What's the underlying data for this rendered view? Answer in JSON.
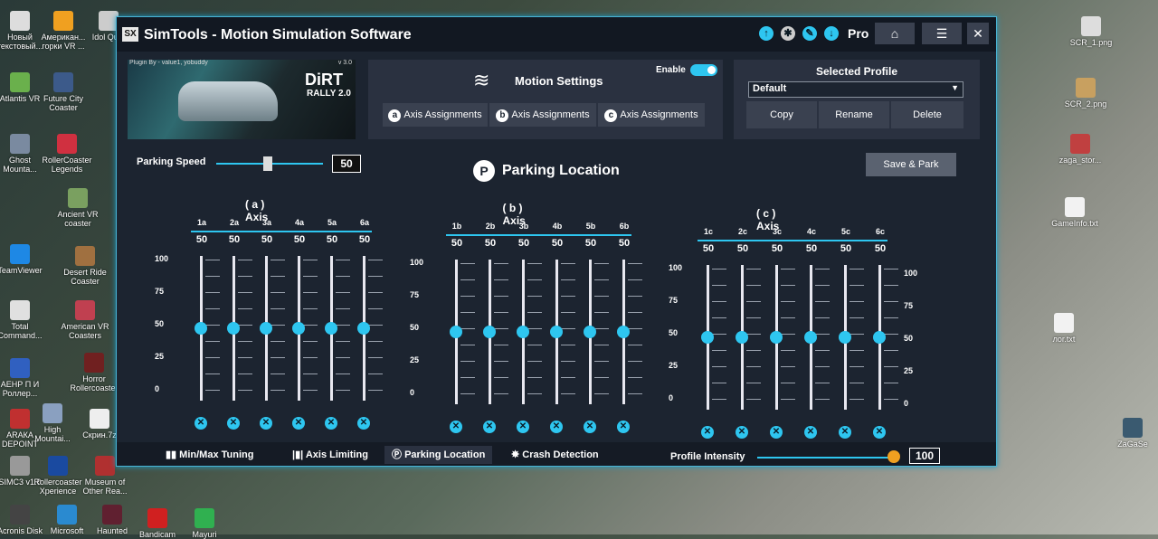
{
  "desktop": {
    "icons_left_col1": [
      "Новый\nтекстовый...",
      "Atlantis VR",
      "Ghost\nMounta...",
      "TeamViewer",
      "Total\nCommand...",
      "АЕНР П И\nРоллер...",
      "АRАКА\nDEPOINT",
      "SIMC3 v1.0",
      "Acronis Disk"
    ],
    "icons_left_col2": [
      "Американ...\nгорки VR ...",
      "Future City\nCoaster",
      "RollerCoaster\nLegends",
      "Ancient VR\ncoaster",
      "Desert Ride\nCoaster",
      "American VR\nCoasters",
      "Horror\nRollercoaster",
      "High\nMountai...",
      "Rollercoaster\nXperience",
      "Microsoft"
    ],
    "icons_left_col3": [
      "Idol Qu...",
      "Скрин.7z",
      "Museum of\nOther Rea...",
      "Haunted"
    ],
    "icons_bottom": [
      "Bandicam",
      "Mayuri"
    ],
    "icons_right": [
      "SCR_1.png",
      "SCR_2.png",
      "zaga_stor...",
      "GameInfo.txt",
      "лor.txt",
      "ZaGaSe"
    ]
  },
  "window": {
    "title": "SimTools - Motion Simulation Software",
    "logo_text": "SX",
    "edition": "Pro",
    "top_icons": [
      "arrow-up-icon",
      "gear-icon",
      "pencil-icon",
      "arrow-down-icon"
    ],
    "buttons": {
      "home": "⌂",
      "menu": "☰",
      "close": "✕"
    }
  },
  "plugin": {
    "by": "Plugin By - value1, yobuddy",
    "version": "v 3.0",
    "game_logo_1": "DiRT",
    "game_logo_2": "RALLY 2.0"
  },
  "motion": {
    "title": "Motion Settings",
    "enable_label": "Enable",
    "enabled": true,
    "axis_buttons": [
      {
        "letter": "a",
        "label": "Axis Assignments"
      },
      {
        "letter": "b",
        "label": "Axis Assignments"
      },
      {
        "letter": "c",
        "label": "Axis Assignments"
      }
    ]
  },
  "profile": {
    "title": "Selected Profile",
    "selected": "Default",
    "buttons": [
      "Copy",
      "Rename",
      "Delete"
    ]
  },
  "parking": {
    "speed_label": "Parking Speed",
    "speed_value": "50",
    "title": "Parking Location",
    "save_label": "Save & Park"
  },
  "axes": [
    {
      "title": "( a ) Axis",
      "channels": [
        "1a",
        "2a",
        "3a",
        "4a",
        "5a",
        "6a"
      ],
      "values": [
        "50",
        "50",
        "50",
        "50",
        "50",
        "50"
      ]
    },
    {
      "title": "( b ) Axis",
      "channels": [
        "1b",
        "2b",
        "3b",
        "4b",
        "5b",
        "6b"
      ],
      "values": [
        "50",
        "50",
        "50",
        "50",
        "50",
        "50"
      ]
    },
    {
      "title": "( c ) Axis",
      "channels": [
        "1c",
        "2c",
        "3c",
        "4c",
        "5c",
        "6c"
      ],
      "values": [
        "50",
        "50",
        "50",
        "50",
        "50",
        "50"
      ]
    }
  ],
  "scale_labels": [
    "100",
    "75",
    "50",
    "25",
    "0"
  ],
  "bottom_tabs": [
    {
      "label": "Min/Max Tuning",
      "active": false
    },
    {
      "label": "Axis Limiting",
      "active": false
    },
    {
      "label": "Parking Location",
      "active": true
    },
    {
      "label": "Crash Detection",
      "active": false
    }
  ],
  "intensity": {
    "label": "Profile Intensity",
    "value": "100"
  },
  "colors": {
    "accent": "#2ec6f0",
    "window_bg": "#1c2430",
    "panel": "#2a3140"
  }
}
